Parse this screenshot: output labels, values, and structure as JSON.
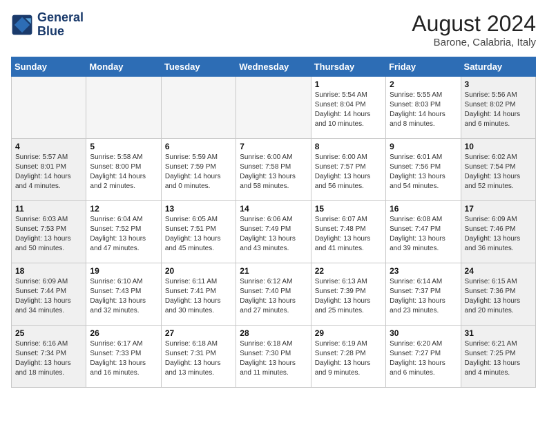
{
  "header": {
    "logo_line1": "General",
    "logo_line2": "Blue",
    "month": "August 2024",
    "location": "Barone, Calabria, Italy"
  },
  "weekdays": [
    "Sunday",
    "Monday",
    "Tuesday",
    "Wednesday",
    "Thursday",
    "Friday",
    "Saturday"
  ],
  "weeks": [
    [
      {
        "day": "",
        "info": "",
        "empty": true
      },
      {
        "day": "",
        "info": "",
        "empty": true
      },
      {
        "day": "",
        "info": "",
        "empty": true
      },
      {
        "day": "",
        "info": "",
        "empty": true
      },
      {
        "day": "1",
        "info": "Sunrise: 5:54 AM\nSunset: 8:04 PM\nDaylight: 14 hours\nand 10 minutes."
      },
      {
        "day": "2",
        "info": "Sunrise: 5:55 AM\nSunset: 8:03 PM\nDaylight: 14 hours\nand 8 minutes."
      },
      {
        "day": "3",
        "info": "Sunrise: 5:56 AM\nSunset: 8:02 PM\nDaylight: 14 hours\nand 6 minutes."
      }
    ],
    [
      {
        "day": "4",
        "info": "Sunrise: 5:57 AM\nSunset: 8:01 PM\nDaylight: 14 hours\nand 4 minutes."
      },
      {
        "day": "5",
        "info": "Sunrise: 5:58 AM\nSunset: 8:00 PM\nDaylight: 14 hours\nand 2 minutes."
      },
      {
        "day": "6",
        "info": "Sunrise: 5:59 AM\nSunset: 7:59 PM\nDaylight: 14 hours\nand 0 minutes."
      },
      {
        "day": "7",
        "info": "Sunrise: 6:00 AM\nSunset: 7:58 PM\nDaylight: 13 hours\nand 58 minutes."
      },
      {
        "day": "8",
        "info": "Sunrise: 6:00 AM\nSunset: 7:57 PM\nDaylight: 13 hours\nand 56 minutes."
      },
      {
        "day": "9",
        "info": "Sunrise: 6:01 AM\nSunset: 7:56 PM\nDaylight: 13 hours\nand 54 minutes."
      },
      {
        "day": "10",
        "info": "Sunrise: 6:02 AM\nSunset: 7:54 PM\nDaylight: 13 hours\nand 52 minutes."
      }
    ],
    [
      {
        "day": "11",
        "info": "Sunrise: 6:03 AM\nSunset: 7:53 PM\nDaylight: 13 hours\nand 50 minutes."
      },
      {
        "day": "12",
        "info": "Sunrise: 6:04 AM\nSunset: 7:52 PM\nDaylight: 13 hours\nand 47 minutes."
      },
      {
        "day": "13",
        "info": "Sunrise: 6:05 AM\nSunset: 7:51 PM\nDaylight: 13 hours\nand 45 minutes."
      },
      {
        "day": "14",
        "info": "Sunrise: 6:06 AM\nSunset: 7:49 PM\nDaylight: 13 hours\nand 43 minutes."
      },
      {
        "day": "15",
        "info": "Sunrise: 6:07 AM\nSunset: 7:48 PM\nDaylight: 13 hours\nand 41 minutes."
      },
      {
        "day": "16",
        "info": "Sunrise: 6:08 AM\nSunset: 7:47 PM\nDaylight: 13 hours\nand 39 minutes."
      },
      {
        "day": "17",
        "info": "Sunrise: 6:09 AM\nSunset: 7:46 PM\nDaylight: 13 hours\nand 36 minutes."
      }
    ],
    [
      {
        "day": "18",
        "info": "Sunrise: 6:09 AM\nSunset: 7:44 PM\nDaylight: 13 hours\nand 34 minutes."
      },
      {
        "day": "19",
        "info": "Sunrise: 6:10 AM\nSunset: 7:43 PM\nDaylight: 13 hours\nand 32 minutes."
      },
      {
        "day": "20",
        "info": "Sunrise: 6:11 AM\nSunset: 7:41 PM\nDaylight: 13 hours\nand 30 minutes."
      },
      {
        "day": "21",
        "info": "Sunrise: 6:12 AM\nSunset: 7:40 PM\nDaylight: 13 hours\nand 27 minutes."
      },
      {
        "day": "22",
        "info": "Sunrise: 6:13 AM\nSunset: 7:39 PM\nDaylight: 13 hours\nand 25 minutes."
      },
      {
        "day": "23",
        "info": "Sunrise: 6:14 AM\nSunset: 7:37 PM\nDaylight: 13 hours\nand 23 minutes."
      },
      {
        "day": "24",
        "info": "Sunrise: 6:15 AM\nSunset: 7:36 PM\nDaylight: 13 hours\nand 20 minutes."
      }
    ],
    [
      {
        "day": "25",
        "info": "Sunrise: 6:16 AM\nSunset: 7:34 PM\nDaylight: 13 hours\nand 18 minutes."
      },
      {
        "day": "26",
        "info": "Sunrise: 6:17 AM\nSunset: 7:33 PM\nDaylight: 13 hours\nand 16 minutes."
      },
      {
        "day": "27",
        "info": "Sunrise: 6:18 AM\nSunset: 7:31 PM\nDaylight: 13 hours\nand 13 minutes."
      },
      {
        "day": "28",
        "info": "Sunrise: 6:18 AM\nSunset: 7:30 PM\nDaylight: 13 hours\nand 11 minutes."
      },
      {
        "day": "29",
        "info": "Sunrise: 6:19 AM\nSunset: 7:28 PM\nDaylight: 13 hours\nand 9 minutes."
      },
      {
        "day": "30",
        "info": "Sunrise: 6:20 AM\nSunset: 7:27 PM\nDaylight: 13 hours\nand 6 minutes."
      },
      {
        "day": "31",
        "info": "Sunrise: 6:21 AM\nSunset: 7:25 PM\nDaylight: 13 hours\nand 4 minutes."
      }
    ]
  ]
}
